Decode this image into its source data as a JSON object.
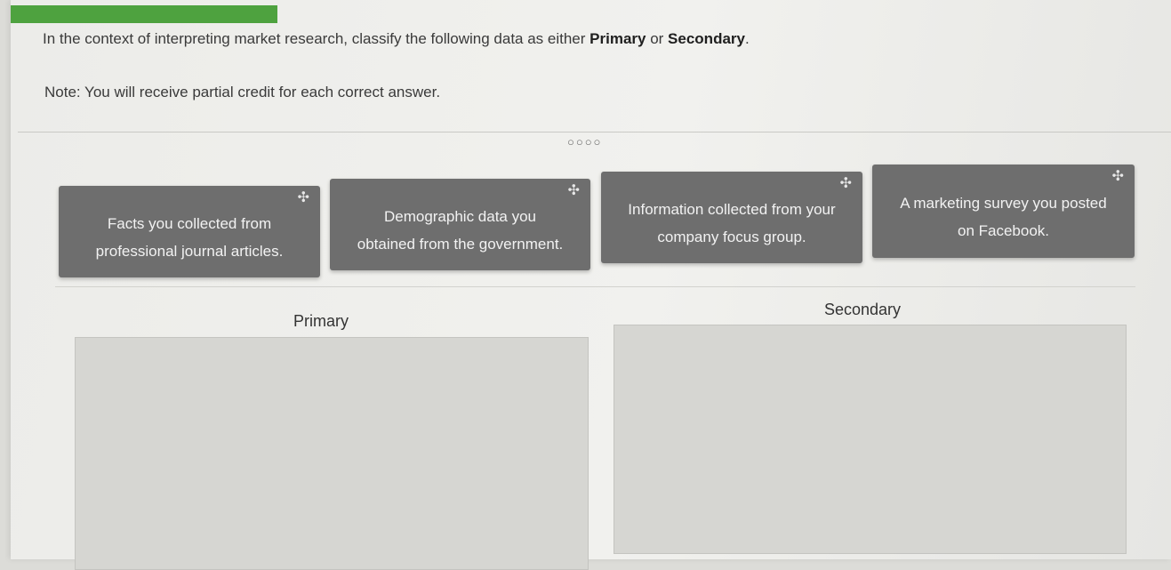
{
  "progress": {
    "percent": 23
  },
  "question": {
    "prompt_before": "In the context of interpreting market research, classify the following data as either ",
    "option_primary": "Primary",
    "prompt_middle": " or ",
    "option_secondary": "Secondary",
    "prompt_after": ".",
    "note": "Note: You will receive partial credit for each correct answer."
  },
  "pager": {
    "dots": "○○○○"
  },
  "cards": [
    {
      "line1": "Facts you collected from",
      "line2": "professional journal articles."
    },
    {
      "line1": "Demographic data you",
      "line2": "obtained from the government."
    },
    {
      "line1": "Information collected from your",
      "line2": "company focus group."
    },
    {
      "line1": "A marketing survey you posted",
      "line2": "on Facebook."
    }
  ],
  "move_icon_glyph": "✣",
  "targets": {
    "primary_label": "Primary",
    "secondary_label": "Secondary"
  },
  "colors": {
    "accent": "#4ea23f",
    "card_bg": "#6e6e6e"
  }
}
